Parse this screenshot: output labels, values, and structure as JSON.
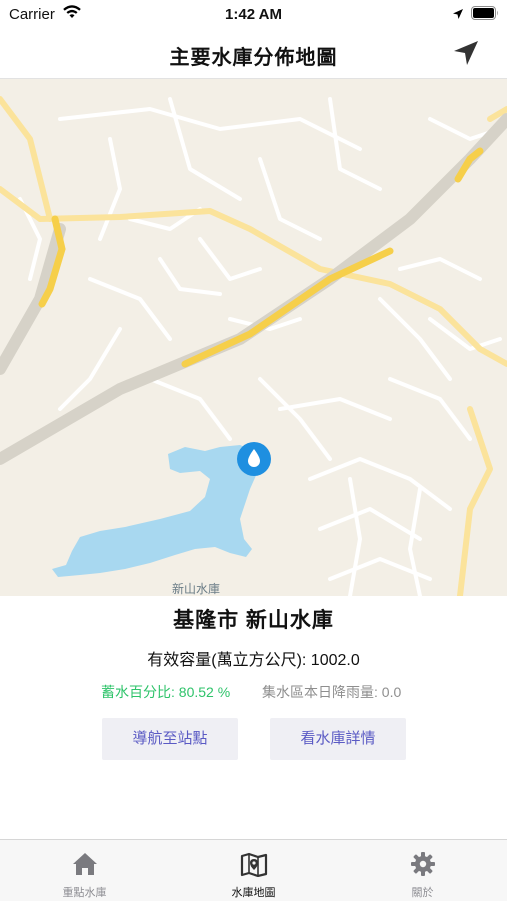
{
  "status_bar": {
    "carrier": "Carrier",
    "time": "1:42 AM"
  },
  "navbar": {
    "title": "主要水庫分佈地圖",
    "locate_icon": "location-arrow-icon"
  },
  "map": {
    "water_label": "新山水庫",
    "pin_icon": "water-drop-icon"
  },
  "reservoir": {
    "name": "基隆市 新山水庫",
    "capacity": "有效容量(萬立方公尺): 1002.0",
    "percentage": "蓄水百分比: 80.52 %",
    "rainfall": "集水區本日降雨量: 0.0"
  },
  "buttons": {
    "navigate": "導航至站點",
    "details": "看水庫詳情"
  },
  "tabs": [
    {
      "label": "重點水庫",
      "icon": "home-icon",
      "active": false
    },
    {
      "label": "水庫地圖",
      "icon": "map-icon",
      "active": true
    },
    {
      "label": "關於",
      "icon": "gear-icon",
      "active": false
    }
  ],
  "colors": {
    "accent": "#5a5ac4",
    "percentage_green": "#2ec36a",
    "water": "#a8d8f0",
    "pin": "#1e8fe0",
    "highway": "#f6cf4a"
  }
}
